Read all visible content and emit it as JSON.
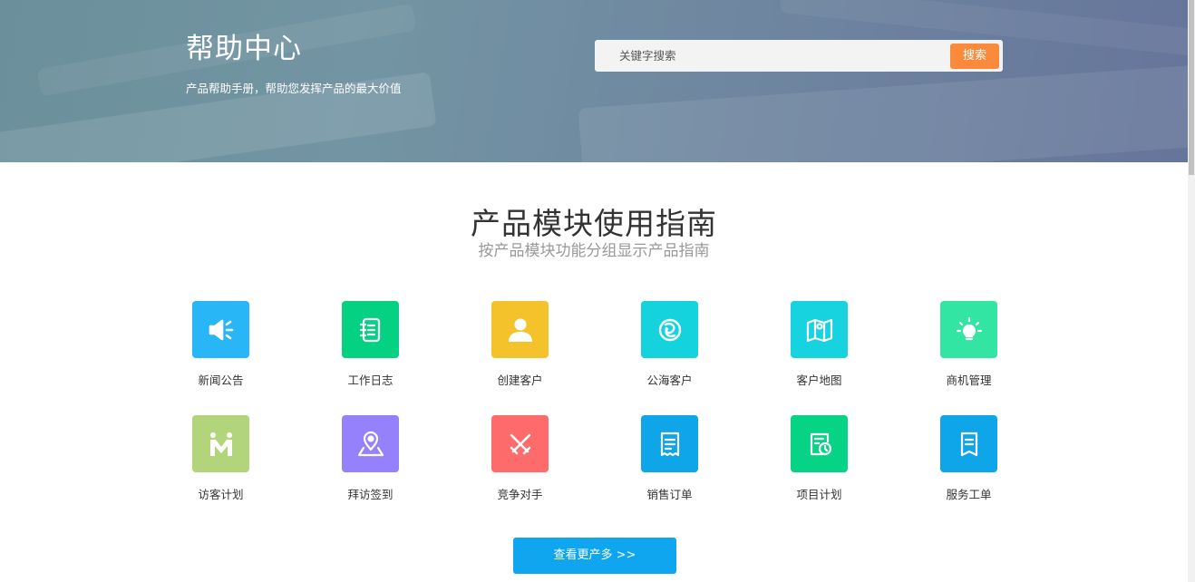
{
  "header": {
    "title": "帮助中心",
    "subtitle": "产品帮助手册，帮助您发挥产品的最大价值"
  },
  "search": {
    "placeholder": "关键字搜索",
    "button_label": "搜索"
  },
  "section": {
    "title": "产品模块使用指南",
    "subtitle": "按产品模块功能分组显示产品指南"
  },
  "modules": [
    {
      "label": "新闻公告",
      "icon": "megaphone-icon",
      "color": "#29b6f6"
    },
    {
      "label": "工作日志",
      "icon": "notebook-icon",
      "color": "#05d183"
    },
    {
      "label": "创建客户",
      "icon": "user-icon",
      "color": "#f4c22b"
    },
    {
      "label": "公海客户",
      "icon": "globe-link-icon",
      "color": "#14d3dd"
    },
    {
      "label": "客户地图",
      "icon": "map-icon",
      "color": "#16d3df"
    },
    {
      "label": "商机管理",
      "icon": "lightbulb-icon",
      "color": "#32e5a3"
    },
    {
      "label": "访客计划",
      "icon": "visitor-icon",
      "color": "#b2d57c"
    },
    {
      "label": "拜访签到",
      "icon": "location-pin-icon",
      "color": "#9481fb"
    },
    {
      "label": "竞争对手",
      "icon": "crossed-swords-icon",
      "color": "#fe6b6b"
    },
    {
      "label": "销售订单",
      "icon": "receipt-icon",
      "color": "#0ea5e9"
    },
    {
      "label": "项目计划",
      "icon": "schedule-clock-icon",
      "color": "#06d384"
    },
    {
      "label": "服务工单",
      "icon": "ticket-icon",
      "color": "#0ea5e9"
    }
  ],
  "more_button": {
    "label": "查看更产多 >>"
  }
}
